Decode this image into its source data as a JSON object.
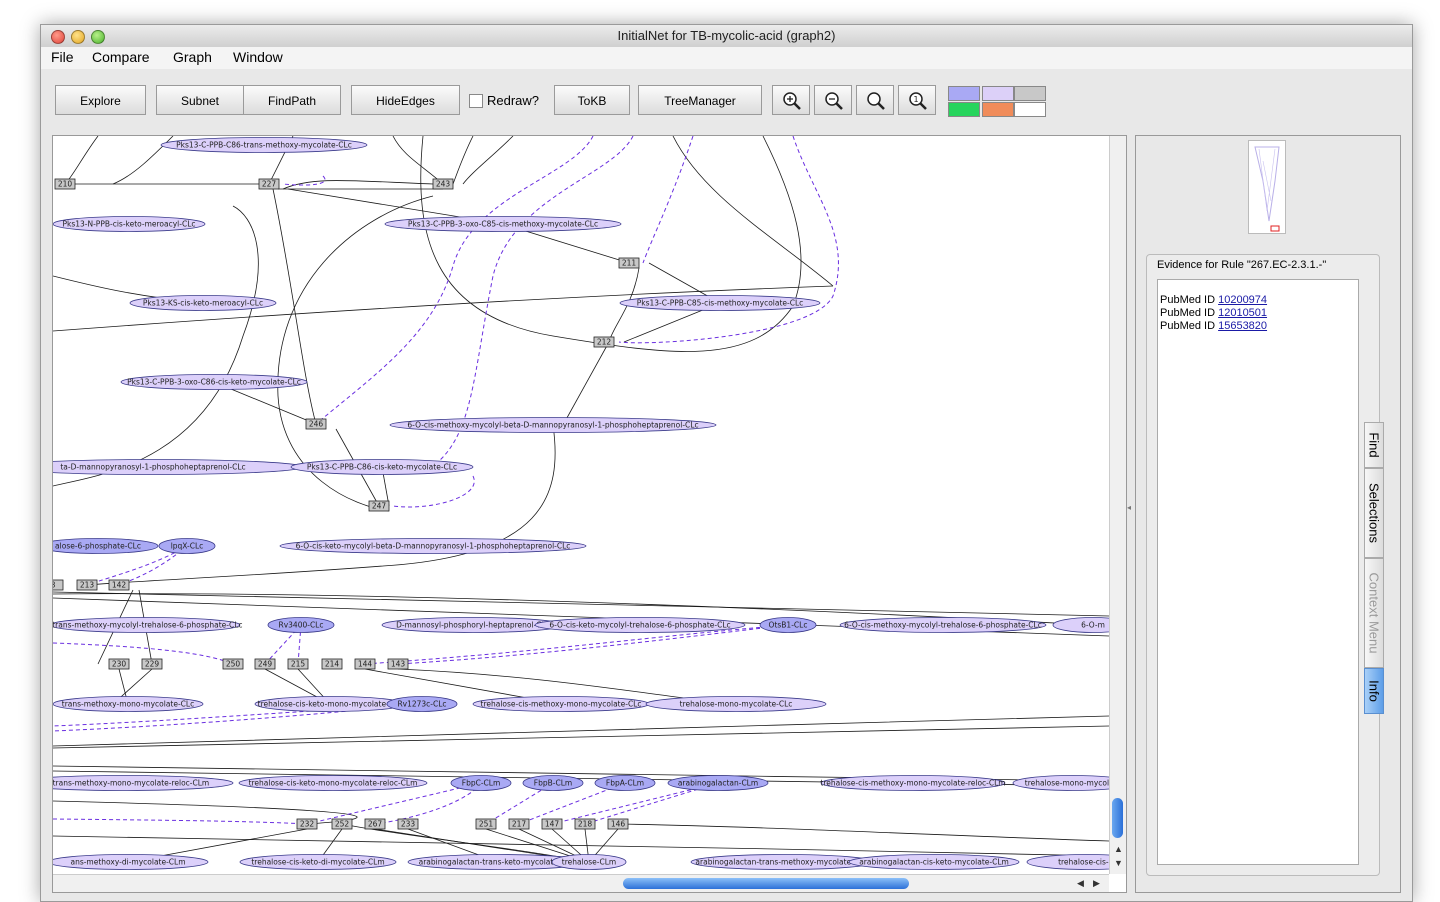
{
  "window": {
    "title": "InitialNet for TB-mycolic-acid (graph2)"
  },
  "menu": [
    "File",
    "Compare",
    "Graph",
    "Window"
  ],
  "toolbar": {
    "explore": "Explore",
    "subnet": "Subnet",
    "findpath": "FindPath",
    "hideedges": "HideEdges",
    "redraw": "Redraw?",
    "tokb": "ToKB",
    "treemanager": "TreeManager",
    "icons": [
      "zoom-in-icon",
      "zoom-out-icon",
      "zoom-fit-icon",
      "zoom-reset-icon"
    ],
    "swatches": [
      "#a9a9f4",
      "#dcd0f8",
      "#c8c8c8",
      "#27d45c",
      "#f08c5a",
      "#ffffff"
    ]
  },
  "graph": {
    "ellipses": [
      {
        "t": "Pks13-C-PPB-C86-trans-methoxy-mycolate-CLc",
        "c": "#dcd0fa"
      },
      {
        "t": "Pks13-N-PPB-cis-keto-meroacyl-CLc",
        "c": "#dcd0fa"
      },
      {
        "t": "Pks13-C-PPB-3-oxo-C85-cis-methoxy-mycolate-CLc",
        "c": "#dcd0fa"
      },
      {
        "t": "Pks13-KS-cis-keto-meroacyl-CLc",
        "c": "#dcd0fa"
      },
      {
        "t": "Pks13-C-PPB-C85-cis-methoxy-mycolate-CLc",
        "c": "#dcd0fa"
      },
      {
        "t": "Pks13-C-PPB-3-oxo-C86-cis-keto-mycolate-CLc",
        "c": "#dcd0fa"
      },
      {
        "t": "6-O-cis-methoxy-mycolyl-beta-D-mannopyranosyl-1-phosphoheptaprenol-CLc",
        "c": "#dcd0fa"
      },
      {
        "t": "ta-D-mannopyranosyl-1-phosphoheptaprenol-CLc",
        "c": "#dcd0fa"
      },
      {
        "t": "Pks13-C-PPB-C86-cis-keto-mycolate-CLc",
        "c": "#dcd0fa"
      },
      {
        "t": "alose-6-phosphate-CLc",
        "c": "#a9a9f4"
      },
      {
        "t": "lpqX-CLc",
        "c": "#a9a9f4"
      },
      {
        "t": "6-O-cis-keto-mycolyl-beta-D-mannopyranosyl-1-phosphoheptaprenol-CLc",
        "c": "#dcd0fa"
      },
      {
        "t": "i-trans-methoxy-mycolyl-trehalose-6-phosphate-CLc",
        "c": "#dcd0fa"
      },
      {
        "t": "Rv3400-CLc",
        "c": "#a9a9f4"
      },
      {
        "t": "D-mannosyl-phosphoryl-heptaprenol-CLc",
        "c": "#dcd0fa"
      },
      {
        "t": "6-O-cis-keto-mycolyl-trehalose-6-phosphate-CLc",
        "c": "#dcd0fa"
      },
      {
        "t": "OtsB1-CLc",
        "c": "#a9a9f4"
      },
      {
        "t": "6-O-cis-methoxy-mycolyl-trehalose-6-phosphate-CLc",
        "c": "#dcd0fa"
      },
      {
        "t": "6-O-m",
        "c": "#dcd0fa"
      },
      {
        "t": "trans-methoxy-mono-mycolate-CLc",
        "c": "#dcd0fa"
      },
      {
        "t": "trehalose-cis-keto-mono-mycolate-CLc",
        "c": "#dcd0fa"
      },
      {
        "t": "Rv1273c-CLc",
        "c": "#a9a9f4"
      },
      {
        "t": "trehalose-cis-methoxy-mono-mycolate-CLc",
        "c": "#dcd0fa"
      },
      {
        "t": "trehalose-mono-mycolate-CLc",
        "c": "#dcd0fa"
      },
      {
        "t": "ose-trans-methoxy-mono-mycolate-reloc-CLm",
        "c": "#dcd0fa"
      },
      {
        "t": "trehalose-cis-keto-mono-mycolate-reloc-CLm",
        "c": "#dcd0fa"
      },
      {
        "t": "FbpC-CLm",
        "c": "#a9a9f4"
      },
      {
        "t": "FbpB-CLm",
        "c": "#a9a9f4"
      },
      {
        "t": "FbpA-CLm",
        "c": "#a9a9f4"
      },
      {
        "t": "arabinogalactan-CLm",
        "c": "#a9a9f4"
      },
      {
        "t": "trehalose-cis-methoxy-mono-mycolate-reloc-CLm",
        "c": "#dcd0fa"
      },
      {
        "t": "trehalose-mono-mycolate",
        "c": "#dcd0fa"
      },
      {
        "t": "ans-methoxy-di-mycolate-CLm",
        "c": "#dcd0fa"
      },
      {
        "t": "trehalose-cis-keto-di-mycolate-CLm",
        "c": "#dcd0fa"
      },
      {
        "t": "arabinogalactan-trans-keto-mycolate-CLm",
        "c": "#dcd0fa"
      },
      {
        "t": "trehalose-CLm",
        "c": "#dcd0fa"
      },
      {
        "t": "arabinogalactan-trans-methoxy-mycolate-CLm",
        "c": "#dcd0fa"
      },
      {
        "t": "arabinogalactan-cis-keto-mycolate-CLm",
        "c": "#dcd0fa"
      },
      {
        "t": "trehalose-cis-m",
        "c": "#dcd0fa"
      }
    ],
    "boxes": [
      "210",
      "227",
      "243",
      "211",
      "212",
      "246",
      "247",
      "8",
      "213",
      "142",
      "230",
      "229",
      "250",
      "249",
      "215",
      "214",
      "144",
      "143",
      "232",
      "252",
      "267",
      "233",
      "251",
      "217",
      "147",
      "218",
      "146"
    ]
  },
  "side": {
    "evidence_title": "Evidence for Rule \"267.EC-2.3.1.-\"",
    "pubmed_label": "PubMed ID",
    "pubmed_ids": [
      "10200974",
      "12010501",
      "15653820"
    ],
    "tabs": [
      "Find",
      "Selections",
      "Context Menu",
      "Info"
    ]
  }
}
